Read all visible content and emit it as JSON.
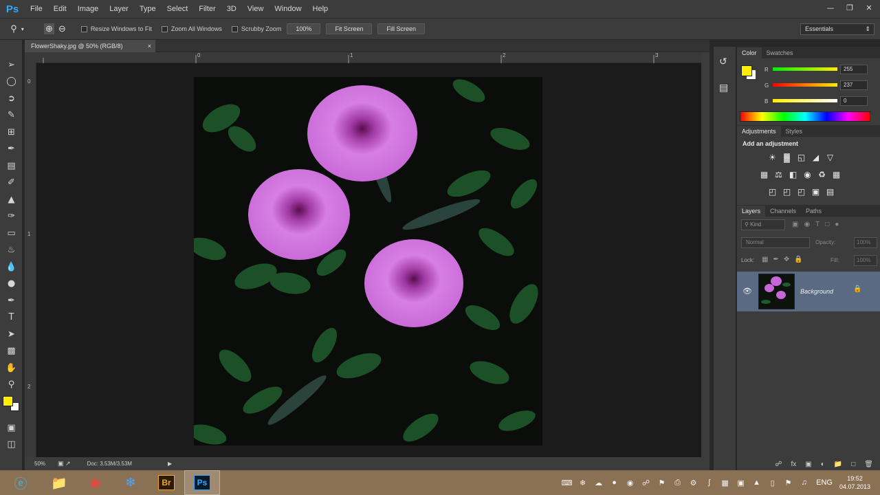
{
  "app": {
    "logo": "Ps"
  },
  "menu": [
    "File",
    "Edit",
    "Image",
    "Layer",
    "Type",
    "Select",
    "Filter",
    "3D",
    "View",
    "Window",
    "Help"
  ],
  "options": {
    "resize_windows": "Resize Windows to Fit",
    "zoom_all": "Zoom All Windows",
    "scrubby_zoom": "Scrubby Zoom",
    "btn_100": "100%",
    "btn_fit": "Fit Screen",
    "btn_fill": "Fill Screen",
    "workspace": "Essentials"
  },
  "document": {
    "tab_title": "FlowerShaky.jpg @ 50% (RGB/8)",
    "close": "×",
    "ruler_h": [
      "0",
      "1",
      "2",
      "3"
    ],
    "ruler_v": [
      "0",
      "1",
      "2"
    ],
    "zoom": "50%",
    "doc_info": "Doc: 3.53M/3.53M"
  },
  "color_panel": {
    "tabs": [
      "Color",
      "Swatches"
    ],
    "channels": [
      {
        "label": "R",
        "value": "255"
      },
      {
        "label": "G",
        "value": "237"
      },
      {
        "label": "B",
        "value": "0"
      }
    ],
    "foreground": "#ffee00"
  },
  "adjustments_panel": {
    "tabs": [
      "Adjustments",
      "Styles"
    ],
    "heading": "Add an adjustment"
  },
  "layers_panel": {
    "tabs": [
      "Layers",
      "Channels",
      "Paths"
    ],
    "filter_kind": "Kind",
    "blend_mode": "Normal",
    "opacity_label": "Opacity:",
    "opacity_value": "100%",
    "lock_label": "Lock:",
    "fill_label": "Fill:",
    "fill_value": "100%",
    "layer_name": "Background"
  },
  "taskbar": {
    "lang": "ENG",
    "time": "19:52",
    "date": "04.07.2013"
  }
}
